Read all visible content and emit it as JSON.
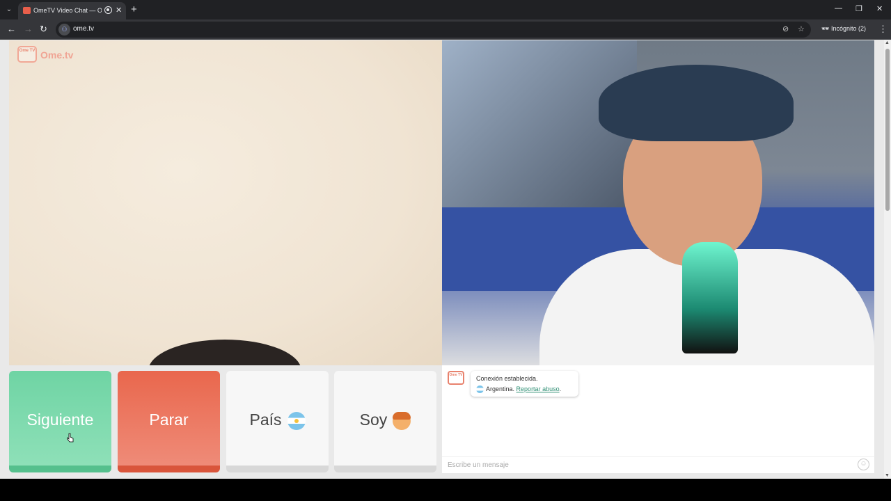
{
  "browser": {
    "tab_title": "OmeTV Video Chat — Ome",
    "tab_close": "✕",
    "new_tab": "+",
    "url": "ome.tv",
    "incognito_label": "Incógnito (2)",
    "window_controls": {
      "minimize": "—",
      "restore": "❐",
      "close": "✕"
    }
  },
  "logo": {
    "brand": "Ome.tv",
    "badge": "Ome TV"
  },
  "buttons": {
    "next": "Siguiente",
    "stop": "Parar",
    "country": "País",
    "gender": "Soy"
  },
  "chat": {
    "logo_badge": "Ome TV",
    "status": "Conexión establecida.",
    "country": "Argentina.",
    "report": "Reportar abuso",
    "report_suffix": ".",
    "input_placeholder": "Escribe un mensaje"
  },
  "colors": {
    "next": "#6fd4a4",
    "stop": "#e9674d",
    "neutral": "#f7f7f7",
    "link": "#2f8f74"
  },
  "icons": {
    "country_flag": "argentina-flag-icon",
    "gender": "boy-face-icon",
    "emoji": "smiley-icon"
  }
}
